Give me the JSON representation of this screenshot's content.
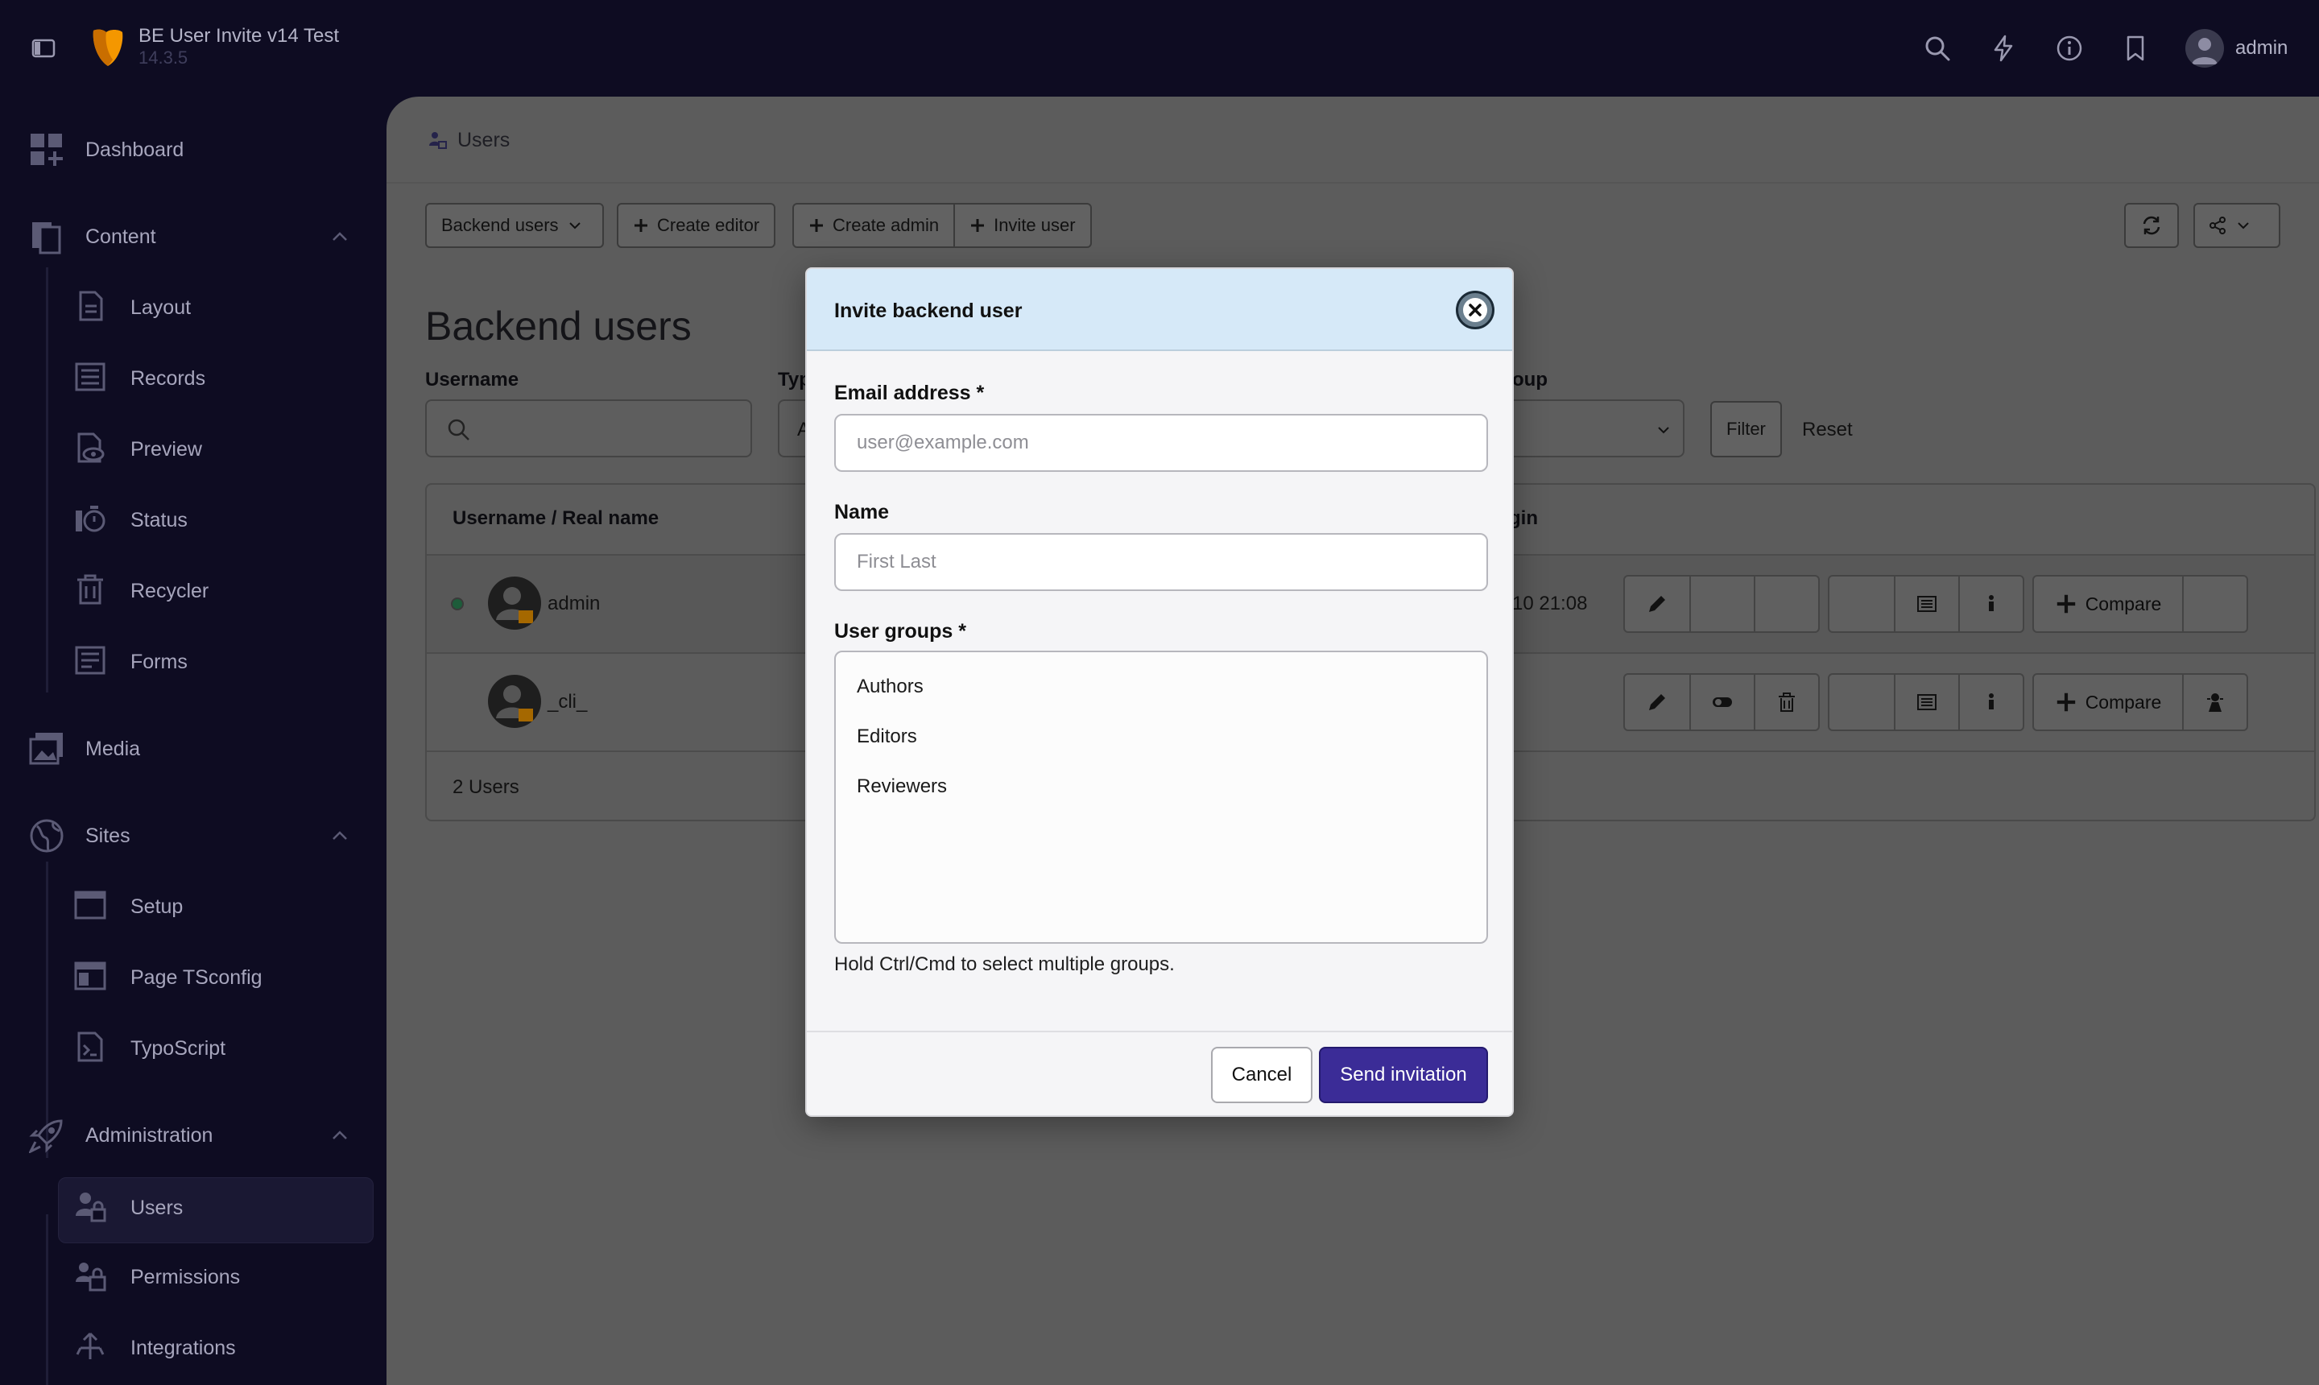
{
  "app": {
    "title": "BE User Invite v14 Test",
    "version": "14.3.5",
    "username": "admin"
  },
  "topbar_icons": [
    "search-icon",
    "lightning-icon",
    "info-icon",
    "bookmark-icon"
  ],
  "sidebar": {
    "items": [
      {
        "label": "Dashboard",
        "icon": "dashboard-icon"
      },
      {
        "label": "Content",
        "icon": "content-icon",
        "expanded": true
      },
      {
        "label": "Layout",
        "icon": "layout-icon"
      },
      {
        "label": "Records",
        "icon": "records-icon"
      },
      {
        "label": "Preview",
        "icon": "preview-icon"
      },
      {
        "label": "Status",
        "icon": "status-icon"
      },
      {
        "label": "Recycler",
        "icon": "recycler-icon"
      },
      {
        "label": "Forms",
        "icon": "forms-icon"
      },
      {
        "label": "Media",
        "icon": "media-icon"
      },
      {
        "label": "Sites",
        "icon": "sites-icon",
        "expanded": true
      },
      {
        "label": "Setup",
        "icon": "setup-icon"
      },
      {
        "label": "Page TSconfig",
        "icon": "tsconfig-icon"
      },
      {
        "label": "TypoScript",
        "icon": "typoscript-icon"
      },
      {
        "label": "Administration",
        "icon": "administration-icon",
        "expanded": true
      },
      {
        "label": "Users",
        "icon": "users-icon",
        "active": true
      },
      {
        "label": "Permissions",
        "icon": "permissions-icon"
      },
      {
        "label": "Integrations",
        "icon": "integrations-icon"
      }
    ]
  },
  "breadcrumb": {
    "label": "Users"
  },
  "toolbar": {
    "module_select": "Backend users",
    "create_editor": "Create editor",
    "create_admin": "Create admin",
    "invite_user": "Invite user"
  },
  "page": {
    "title": "Backend users",
    "filters": {
      "username_label": "Username",
      "type_label": "Typ",
      "group_label": "oup",
      "type_value": "A",
      "filter_button": "Filter",
      "reset_button": "Reset"
    },
    "table": {
      "header_name": "Username / Real name",
      "header_login": "gin",
      "rows": [
        {
          "username": "admin",
          "last_login": "-10 21:08",
          "online": true,
          "compare": "Compare"
        },
        {
          "username": "_cli_",
          "last_login": "",
          "online": false,
          "compare": "Compare"
        }
      ],
      "count": "2 Users"
    }
  },
  "modal": {
    "title": "Invite backend user",
    "email_label": "Email address *",
    "email_placeholder": "user@example.com",
    "email_value": "",
    "name_label": "Name",
    "name_placeholder": "First Last",
    "name_value": "",
    "groups_label": "User groups *",
    "groups": [
      "Authors",
      "Editors",
      "Reviewers"
    ],
    "help": "Hold Ctrl/Cmd to select multiple groups.",
    "cancel": "Cancel",
    "send": "Send invitation"
  }
}
